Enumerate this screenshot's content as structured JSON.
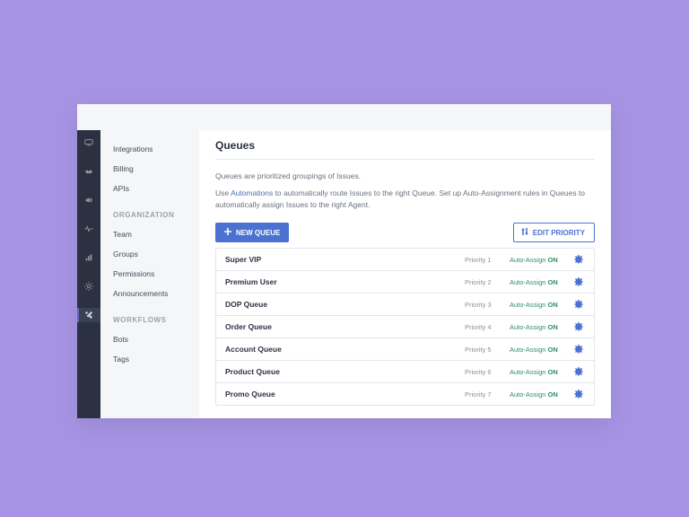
{
  "page": {
    "title": "Queues"
  },
  "intro": {
    "line1": "Queues are prioritized groupings of Issues.",
    "line2a": "Use ",
    "link": "Automations",
    "line2b": " to automatically route Issues to the right Queue. Set up Auto-Assignment rules in Queues to automatically assign Issues to the right Agent."
  },
  "toolbar": {
    "new_queue": "NEW QUEUE",
    "edit_priority": "EDIT PRIORITY"
  },
  "sidebar": {
    "top_links": [
      {
        "label": "Integrations"
      },
      {
        "label": "Billing"
      },
      {
        "label": "APIs"
      }
    ],
    "organization_heading": "ORGANIZATION",
    "organization_links": [
      {
        "label": "Team"
      },
      {
        "label": "Groups"
      },
      {
        "label": "Permissions"
      },
      {
        "label": "Announcements"
      }
    ],
    "workflows_heading": "WORKFLOWS",
    "workflows_links": [
      {
        "label": "Bots"
      },
      {
        "label": "Tags"
      }
    ]
  },
  "rail": {
    "items": [
      {
        "icon": "monitor"
      },
      {
        "icon": "handshake"
      },
      {
        "icon": "megaphone"
      },
      {
        "icon": "pulse"
      },
      {
        "icon": "bars"
      },
      {
        "icon": "gear"
      },
      {
        "icon": "tools",
        "active": true
      }
    ]
  },
  "queues": [
    {
      "name": "Super VIP",
      "priority": "Priority 1",
      "auto_prefix": "Auto-Assign ",
      "auto_state": "ON"
    },
    {
      "name": "Premium User",
      "priority": "Priority 2",
      "auto_prefix": "Auto-Assign ",
      "auto_state": "ON"
    },
    {
      "name": "DOP Queue",
      "priority": "Priority 3",
      "auto_prefix": "Auto-Assign ",
      "auto_state": "ON"
    },
    {
      "name": "Order Queue",
      "priority": "Priority 4",
      "auto_prefix": "Auto-Assign ",
      "auto_state": "ON"
    },
    {
      "name": "Account Queue",
      "priority": "Priority 5",
      "auto_prefix": "Auto-Assign ",
      "auto_state": "ON"
    },
    {
      "name": "Product Queue",
      "priority": "Priority 6",
      "auto_prefix": "Auto-Assign ",
      "auto_state": "ON"
    },
    {
      "name": "Promo Queue",
      "priority": "Priority 7",
      "auto_prefix": "Auto-Assign ",
      "auto_state": "ON"
    }
  ],
  "colors": {
    "accent": "#4c72d1",
    "success": "#2f8f63",
    "rail": "#2b3140"
  }
}
